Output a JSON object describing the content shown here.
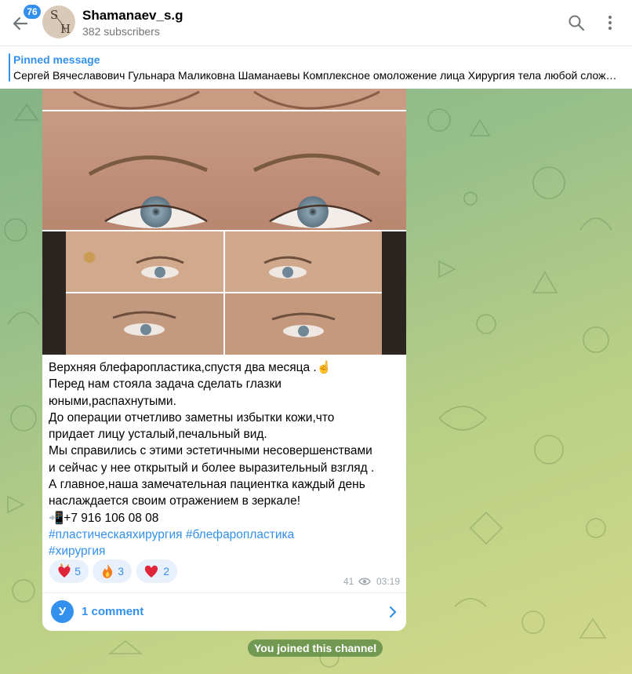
{
  "header": {
    "unread_badge": "76",
    "avatar_letters": [
      "S",
      "H"
    ],
    "channel_name": "Shamanaev_s.g",
    "subscribers": "382 subscribers"
  },
  "pinned": {
    "title": "Pinned message",
    "text": "Сергей Вячеславович Гульнара Маликовна Шаманаевы Комплексное омоложение лица Хирургия тела любой слож…"
  },
  "post": {
    "caption_lines": [
      "Верхняя блефаропластика,спустя два месяца .☝️",
      "Перед нам стояла задача сделать глазки",
      "юными,распахнутыми.",
      "До операции отчетливо заметны избытки кожи,что",
      "придает лицу усталый,печальный вид.",
      "Мы справились с этими эстетичными несовершенствами",
      "и сейчас у нее открытый и более выразительный взгляд .",
      "А главное,наша замечательная пациентка каждый день",
      "наслаждается своим отражением в зеркале!",
      "📲+7 916 106 08 08"
    ],
    "hashtags": [
      "#пластическаяхирургия",
      "#блефаропластика",
      "#хирургия"
    ],
    "reactions": [
      {
        "emoji": "heart-on-fire",
        "count": "5"
      },
      {
        "emoji": "fire",
        "count": "3"
      },
      {
        "emoji": "red-heart",
        "count": "2"
      }
    ],
    "views": "41",
    "time": "03:19",
    "comments_avatar": "У",
    "comments_label": "1 comment"
  },
  "service_message": "You joined this channel",
  "colors": {
    "accent": "#3390ec",
    "reaction_bg": "#e8f1fb",
    "service_bg": "#50823c"
  }
}
